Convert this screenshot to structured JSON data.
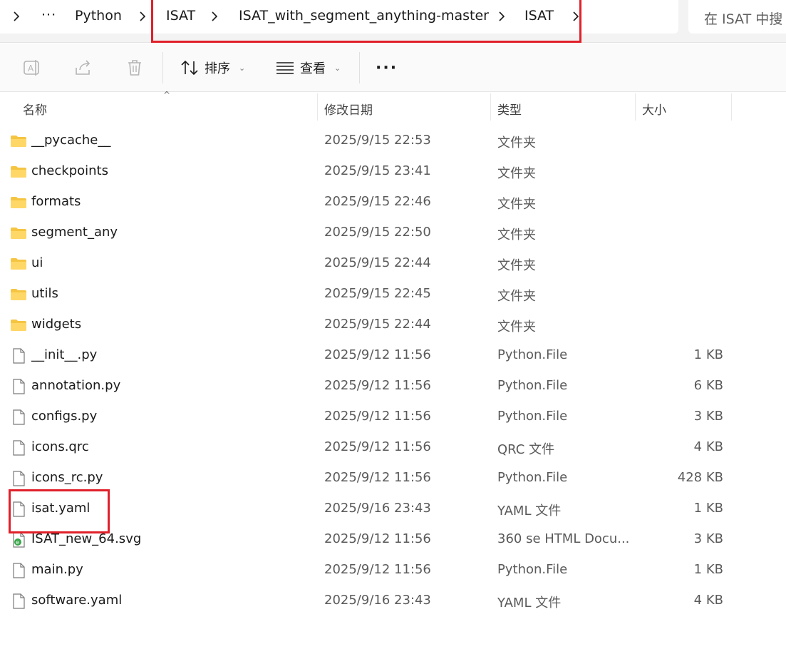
{
  "address_bar": {
    "overflow_label": "···",
    "crumbs": [
      "Python",
      "ISAT",
      "ISAT_with_segment_anything-master",
      "ISAT"
    ]
  },
  "search": {
    "placeholder": "在 ISAT 中搜"
  },
  "toolbar": {
    "sort_label": "排序",
    "view_label": "查看",
    "more_label": "···"
  },
  "columns": {
    "name": "名称",
    "date": "修改日期",
    "type": "类型",
    "size": "大小"
  },
  "files": [
    {
      "name": "__pycache__",
      "date": "2025/9/15 22:53",
      "type": "文件夹",
      "size": "",
      "icon": "folder-icon"
    },
    {
      "name": "checkpoints",
      "date": "2025/9/15 23:41",
      "type": "文件夹",
      "size": "",
      "icon": "folder-icon"
    },
    {
      "name": "formats",
      "date": "2025/9/15 22:46",
      "type": "文件夹",
      "size": "",
      "icon": "folder-icon"
    },
    {
      "name": "segment_any",
      "date": "2025/9/15 22:50",
      "type": "文件夹",
      "size": "",
      "icon": "folder-icon"
    },
    {
      "name": "ui",
      "date": "2025/9/15 22:44",
      "type": "文件夹",
      "size": "",
      "icon": "folder-icon"
    },
    {
      "name": "utils",
      "date": "2025/9/15 22:45",
      "type": "文件夹",
      "size": "",
      "icon": "folder-icon"
    },
    {
      "name": "widgets",
      "date": "2025/9/15 22:44",
      "type": "文件夹",
      "size": "",
      "icon": "folder-icon"
    },
    {
      "name": "__init__.py",
      "date": "2025/9/12 11:56",
      "type": "Python.File",
      "size": "1 KB",
      "icon": "file-icon"
    },
    {
      "name": "annotation.py",
      "date": "2025/9/12 11:56",
      "type": "Python.File",
      "size": "6 KB",
      "icon": "file-icon"
    },
    {
      "name": "configs.py",
      "date": "2025/9/12 11:56",
      "type": "Python.File",
      "size": "3 KB",
      "icon": "file-icon"
    },
    {
      "name": "icons.qrc",
      "date": "2025/9/12 11:56",
      "type": "QRC 文件",
      "size": "4 KB",
      "icon": "file-icon"
    },
    {
      "name": "icons_rc.py",
      "date": "2025/9/12 11:56",
      "type": "Python.File",
      "size": "428 KB",
      "icon": "file-icon"
    },
    {
      "name": "isat.yaml",
      "date": "2025/9/16 23:43",
      "type": "YAML 文件",
      "size": "1 KB",
      "icon": "file-icon"
    },
    {
      "name": "ISAT_new_64.svg",
      "date": "2025/9/12 11:56",
      "type": "360 se HTML Docu...",
      "size": "3 KB",
      "icon": "browser-file-icon"
    },
    {
      "name": "main.py",
      "date": "2025/9/12 11:56",
      "type": "Python.File",
      "size": "1 KB",
      "icon": "file-icon"
    },
    {
      "name": "software.yaml",
      "date": "2025/9/16 23:43",
      "type": "YAML 文件",
      "size": "4 KB",
      "icon": "file-icon"
    }
  ],
  "colors": {
    "highlight": "#e0202a",
    "folder": "#f5c542"
  }
}
